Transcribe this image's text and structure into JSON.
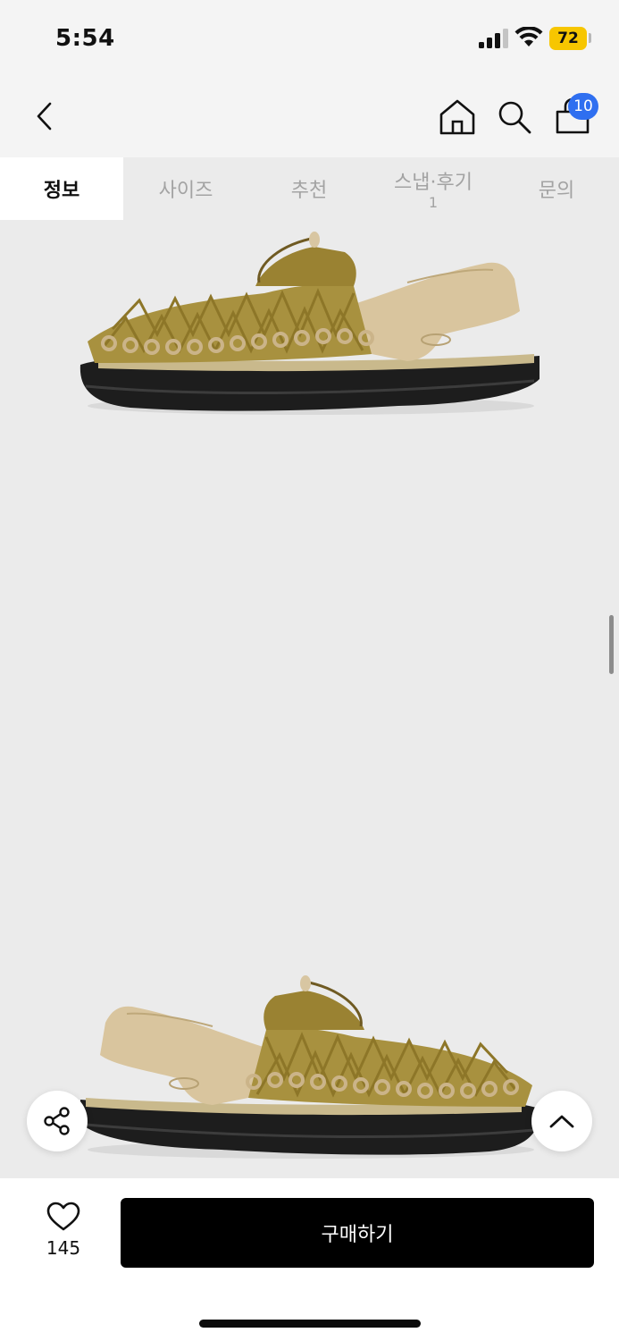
{
  "status_bar": {
    "time": "5:54",
    "battery": "72",
    "battery_color": "#f7c600"
  },
  "header": {
    "back_icon": "chevron-left-icon",
    "home_icon": "home-icon",
    "search_icon": "search-icon",
    "cart_icon": "shopping-bag-icon",
    "cart_badge": "10",
    "badge_color": "#2f6ff0"
  },
  "tabs": [
    {
      "label": "정보",
      "sub": "",
      "active": true
    },
    {
      "label": "사이즈",
      "sub": ""
    },
    {
      "label": "추천",
      "sub": ""
    },
    {
      "label": "스냅·후기",
      "sub": "1"
    },
    {
      "label": "문의",
      "sub": ""
    }
  ],
  "product_images": [
    {
      "icon": "sandal-image-side-right"
    },
    {
      "icon": "sandal-image-side-left"
    }
  ],
  "floating": {
    "share_icon": "share-icon",
    "scroll_top_icon": "chevron-up-icon"
  },
  "bottom_bar": {
    "like_icon": "heart-icon",
    "like_count": "145",
    "buy_label": "구매하기"
  }
}
